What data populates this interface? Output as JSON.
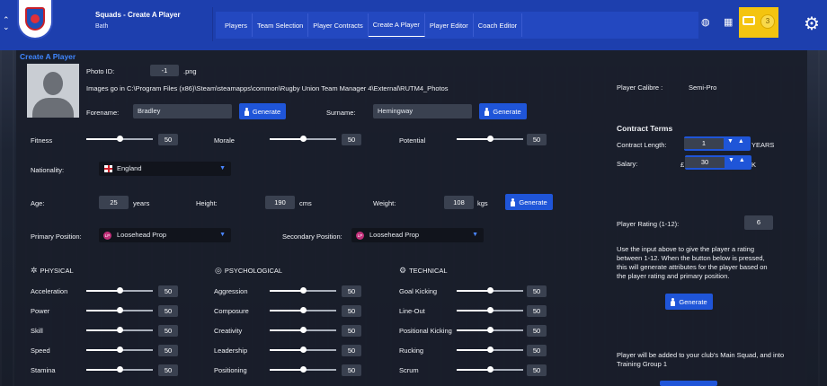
{
  "header": {
    "title": "Squads - Create A Player",
    "subtitle": "Bath",
    "tabs": [
      "Players",
      "Team Selection",
      "Player Contracts",
      "Create A Player",
      "Player Editor",
      "Coach Editor"
    ],
    "active_tab": "Create A Player",
    "inbox_count": "3"
  },
  "panel_title": "Create A Player",
  "photo": {
    "label": "Photo ID:",
    "id_value": "-1",
    "ext": ".png",
    "path_text": "Images go in C:\\Program Files (x86)\\Steam\\steamapps\\common\\Rugby Union Team Manager 4\\External\\RUTM4_Photos"
  },
  "names": {
    "forename_label": "Forename:",
    "forename_value": "Bradley",
    "surname_label": "Surname:",
    "surname_value": "Hemingway",
    "generate_label": "Generate"
  },
  "core": {
    "fitness_label": "Fitness",
    "fitness_value": "50",
    "morale_label": "Morale",
    "morale_value": "50",
    "potential_label": "Potential",
    "potential_value": "50"
  },
  "nationality": {
    "label": "Nationality:",
    "value": "England"
  },
  "body": {
    "age_label": "Age:",
    "age_value": "25",
    "age_unit": "years",
    "height_label": "Height:",
    "height_value": "190",
    "height_unit": "cms",
    "weight_label": "Weight:",
    "weight_value": "108",
    "weight_unit": "kgs",
    "generate_label": "Generate"
  },
  "positions": {
    "primary_label": "Primary Position:",
    "primary_value": "Loosehead Prop",
    "secondary_label": "Secondary Position:",
    "secondary_value": "Loosehead Prop",
    "badge": "LP"
  },
  "sections": {
    "physical": {
      "title": "PHYSICAL",
      "attrs": [
        {
          "label": "Acceleration",
          "value": "50"
        },
        {
          "label": "Power",
          "value": "50"
        },
        {
          "label": "Skill",
          "value": "50"
        },
        {
          "label": "Speed",
          "value": "50"
        },
        {
          "label": "Stamina",
          "value": "50"
        }
      ]
    },
    "psychological": {
      "title": "PSYCHOLOGICAL",
      "attrs": [
        {
          "label": "Aggression",
          "value": "50"
        },
        {
          "label": "Composure",
          "value": "50"
        },
        {
          "label": "Creativity",
          "value": "50"
        },
        {
          "label": "Leadership",
          "value": "50"
        },
        {
          "label": "Positioning",
          "value": "50"
        }
      ]
    },
    "technical": {
      "title": "TECHNICAL",
      "attrs": [
        {
          "label": "Goal Kicking",
          "value": "50"
        },
        {
          "label": "Line-Out",
          "value": "50"
        },
        {
          "label": "Positional Kicking",
          "value": "50"
        },
        {
          "label": "Rucking",
          "value": "50"
        },
        {
          "label": "Scrum",
          "value": "50"
        }
      ]
    }
  },
  "right": {
    "calibre_label": "Player Calibre :",
    "calibre_value": "Semi-Pro",
    "contract_title": "Contract Terms",
    "length_label": "Contract Length:",
    "length_value": "1",
    "length_unit": "YEARS",
    "salary_label": "Salary:",
    "salary_prefix": "£",
    "salary_value": "30",
    "salary_unit": "K",
    "rating_label": "Player Rating (1-12):",
    "rating_value": "6",
    "rating_desc": "Use the input above to give the player a rating between 1-12.  When the button below is pressed, this will generate attributes for the player based on the player rating and primary position.",
    "generate_label": "Generate",
    "footer_note": "Player will be added to your club's Main Squad, and into Training Group 1"
  },
  "slider_level": 0.5,
  "colors": {
    "accent": "#1f55d8",
    "header": "#1d3fae",
    "inbox": "#f4c40f",
    "title_blue": "#3f86ff"
  }
}
